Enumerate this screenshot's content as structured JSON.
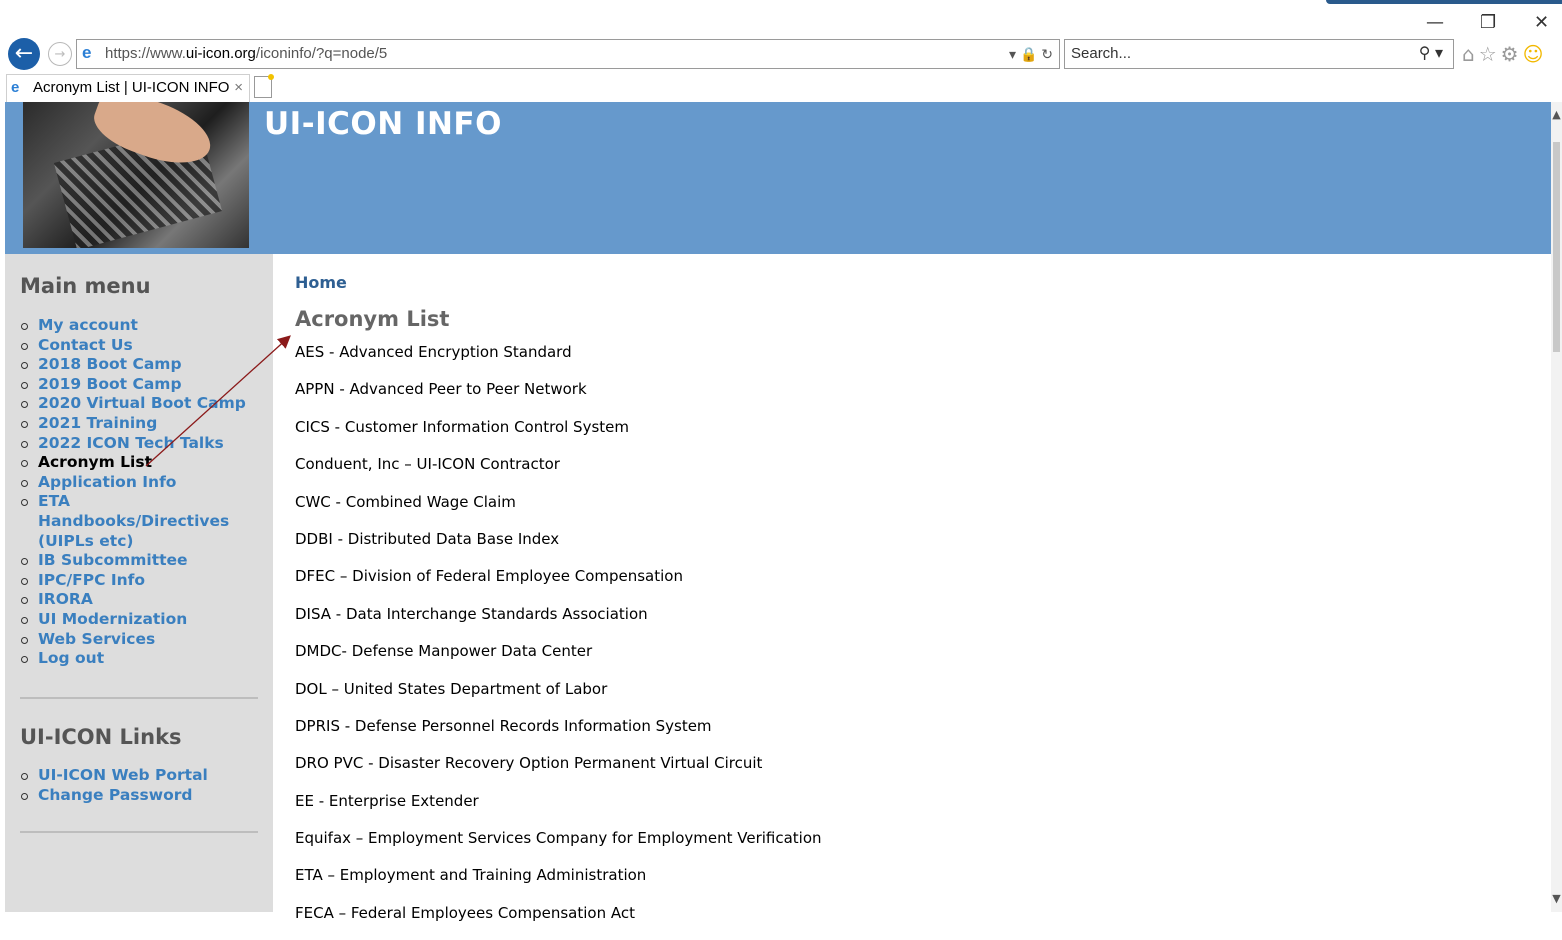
{
  "browser": {
    "url_prefix": "https://www.",
    "url_domain": "ui-icon.org",
    "url_path": "/iconinfo/?q=node/5",
    "search_placeholder": "Search...",
    "tab_title": "Acronym List | UI-ICON INFO",
    "tab_close": "×",
    "back_glyph": "←",
    "forward_glyph": "→",
    "minimize_glyph": "—",
    "restore_glyph": "❐",
    "close_glyph": "✕",
    "addr_tools": "▾ 🔒 ↻",
    "search_glyph": "⚲ ▾",
    "nav_icons": "⌂☆⚙",
    "smile_glyph": "☺",
    "ie_glyph": "e"
  },
  "site": {
    "title": "UI-ICON INFO"
  },
  "sidebar": {
    "main_menu_title": "Main menu",
    "items": [
      {
        "label": "My account"
      },
      {
        "label": "Contact Us"
      },
      {
        "label": "2018 Boot Camp"
      },
      {
        "label": "2019 Boot Camp"
      },
      {
        "label": "2020 Virtual Boot Camp"
      },
      {
        "label": "2021 Training"
      },
      {
        "label": "2022 ICON Tech Talks"
      },
      {
        "label": "Acronym List"
      },
      {
        "label": "Application Info"
      },
      {
        "label": "ETA Handbooks/Directives (UIPLs etc)"
      },
      {
        "label": "IB Subcommittee"
      },
      {
        "label": "IPC/FPC Info"
      },
      {
        "label": "IRORA"
      },
      {
        "label": "UI Modernization"
      },
      {
        "label": "Web Services"
      },
      {
        "label": "Log out"
      }
    ],
    "links_title": "UI-ICON Links",
    "links": [
      {
        "label": "UI-ICON Web Portal"
      },
      {
        "label": "Change Password"
      }
    ]
  },
  "content": {
    "breadcrumb": "Home",
    "title": "Acronym List",
    "acronyms": [
      "AES - Advanced Encryption Standard",
      "APPN - Advanced Peer to Peer Network",
      "CICS - Customer Information Control System",
      "Conduent, Inc – UI-ICON Contractor",
      "CWC - Combined Wage Claim",
      "DDBI - Distributed Data Base Index",
      "DFEC – Division of Federal Employee Compensation",
      "DISA - Data Interchange Standards Association",
      "DMDC- Defense Manpower Data Center",
      "DOL – United States Department of Labor",
      "DPRIS - Defense Personnel Records Information System",
      "DRO PVC - Disaster Recovery Option Permanent Virtual Circuit",
      "EE - Enterprise Extender",
      "Equifax – Employment Services Company for Employment Verification",
      "ETA – Employment and Training Administration",
      "FECA – Federal Employees Compensation Act"
    ]
  },
  "colors": {
    "header_bg": "#6699cc",
    "sidebar_bg": "#dddddd",
    "link": "#3a7fbf",
    "annotation_arrow": "#8b1a1a"
  }
}
